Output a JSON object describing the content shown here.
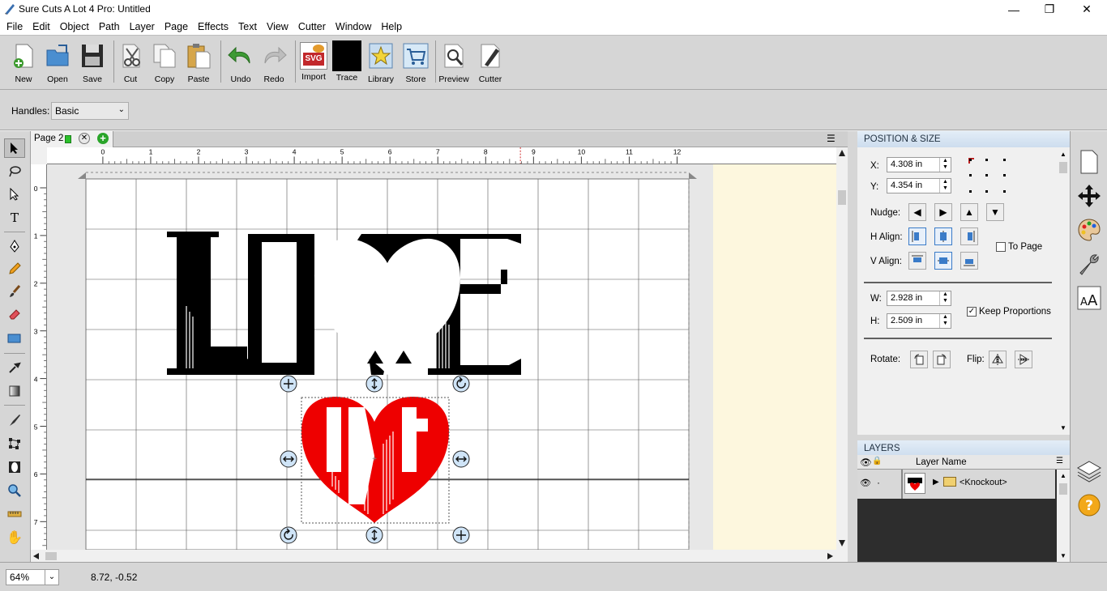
{
  "window": {
    "title": "Sure Cuts A Lot 4 Pro: Untitled",
    "minimize": "—",
    "maximize": "❐",
    "close": "✕"
  },
  "menu": [
    "File",
    "Edit",
    "Object",
    "Path",
    "Layer",
    "Page",
    "Effects",
    "Text",
    "View",
    "Cutter",
    "Window",
    "Help"
  ],
  "toolbar": {
    "new": "New",
    "open": "Open",
    "save": "Save",
    "cut": "Cut",
    "copy": "Copy",
    "paste": "Paste",
    "undo": "Undo",
    "redo": "Redo",
    "import": "Import",
    "trace": "Trace",
    "library": "Library",
    "store": "Store",
    "preview": "Preview",
    "cutter": "Cutter",
    "import_badge": "SVG"
  },
  "handles": {
    "label": "Handles:",
    "value": "Basic"
  },
  "page_tab": {
    "label": "Page 2"
  },
  "ruler": {
    "h_ticks": [
      "0",
      "1",
      "2",
      "3",
      "4",
      "5",
      "6",
      "7",
      "8",
      "9",
      "10",
      "11",
      "12"
    ],
    "v_ticks": [
      "0",
      "1",
      "2",
      "3",
      "4",
      "5",
      "6",
      "7"
    ]
  },
  "status": {
    "zoom": "64%",
    "coords": "8.72, -0.52"
  },
  "position_size": {
    "header": "POSITION & SIZE",
    "x_label": "X:",
    "x_value": "4.308 in",
    "y_label": "Y:",
    "y_value": "4.354 in",
    "nudge_label": "Nudge:",
    "halign_label": "H Align:",
    "valign_label": "V Align:",
    "to_page": "To Page",
    "w_label": "W:",
    "w_value": "2.928 in",
    "h_label": "H:",
    "h_value": "2.509 in",
    "keep_proportions": "Keep Proportions",
    "keep_proportions_checked": "✓",
    "rotate_label": "Rotate:",
    "flip_label": "Flip:"
  },
  "layers": {
    "header": "LAYERS",
    "column": "Layer Name",
    "rows": [
      {
        "name": "<Knockout>"
      }
    ]
  },
  "colors": {
    "accent": "#3a7bc8",
    "heart": "#ee0000",
    "canvas_bg": "#fdf7de"
  }
}
